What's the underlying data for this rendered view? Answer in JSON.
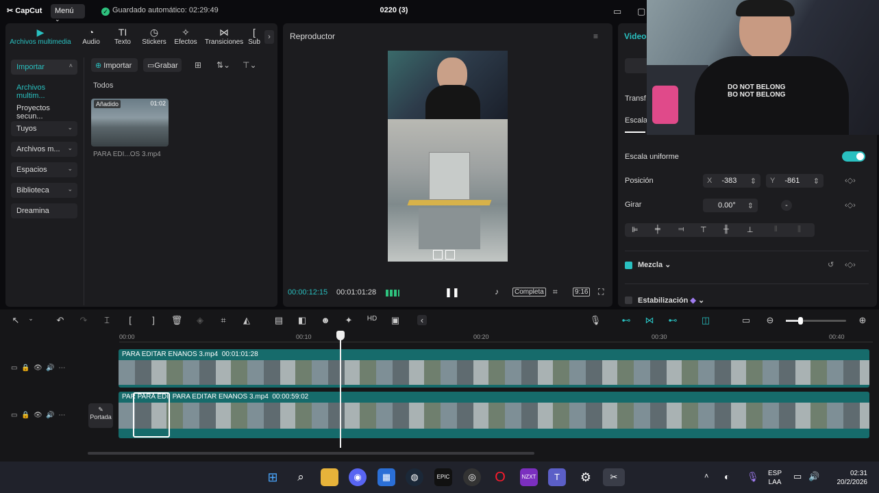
{
  "topbar": {
    "logo": "CapCut",
    "menu": "Menú",
    "autosave": "Guardado automático: 02:29:49",
    "project_title": "0220 (3)"
  },
  "media_tabs": [
    {
      "label": "Archivos multimedia",
      "icon": "media-icon"
    },
    {
      "label": "Audio",
      "icon": "audio-icon"
    },
    {
      "label": "Texto",
      "icon": "text-icon"
    },
    {
      "label": "Stickers",
      "icon": "sticker-icon"
    },
    {
      "label": "Efectos",
      "icon": "effects-icon"
    },
    {
      "label": "Transiciones",
      "icon": "transitions-icon"
    },
    {
      "label": "Sub",
      "icon": "subtitles-icon"
    }
  ],
  "sidebar": [
    {
      "label": "Importar"
    },
    {
      "label": "Archivos multim..."
    },
    {
      "label": "Proyectos secun..."
    },
    {
      "label": "Tuyos"
    },
    {
      "label": "Archivos m..."
    },
    {
      "label": "Espacios"
    },
    {
      "label": "Biblioteca"
    },
    {
      "label": "Dreamina"
    }
  ],
  "media_toolbar": {
    "import": "Importar",
    "record": "Grabar",
    "filter_all": "Todos"
  },
  "media_item": {
    "badge": "Añadido",
    "duration": "01:02",
    "name": "PARA EDI...OS 3.mp4"
  },
  "player": {
    "title": "Reproductor",
    "current_time": "00:00:12:15",
    "total_time": "00:01:01:28",
    "ratio_label": "Completa",
    "aspect": "9:16"
  },
  "props": {
    "tab_video": "Video",
    "section_transform": "Transf",
    "section_scale": "Escala",
    "uniform_scale": "Escala uniforme",
    "position_label": "Posición",
    "x_label": "X",
    "x_value": "-383",
    "y_label": "Y",
    "y_value": "-861",
    "rotate_label": "Girar",
    "rotate_value": "0.00°",
    "blend_label": "Mezcla",
    "stabilize_label": "Estabilización"
  },
  "webcam_shirt": "DO NOT BELONG\nBO NOT BELONG",
  "timeline": {
    "ruler": [
      "00:00",
      "00:10",
      "00:20",
      "00:30",
      "00:40"
    ],
    "clip1": {
      "name": "PARA EDITAR ENANOS 3.mp4",
      "duration": "00:01:01:28"
    },
    "clip2": {
      "name": "PARA EDITAR ENANOS 3.mp4",
      "duration": "00:00:59:02",
      "prefix_a": "PAR",
      "prefix_b": "PARA EDI"
    },
    "cover": "Portada"
  },
  "taskbar": {
    "lang": "ESP",
    "layout": "LAA",
    "time": "02:31",
    "date": "20/2/2026"
  }
}
